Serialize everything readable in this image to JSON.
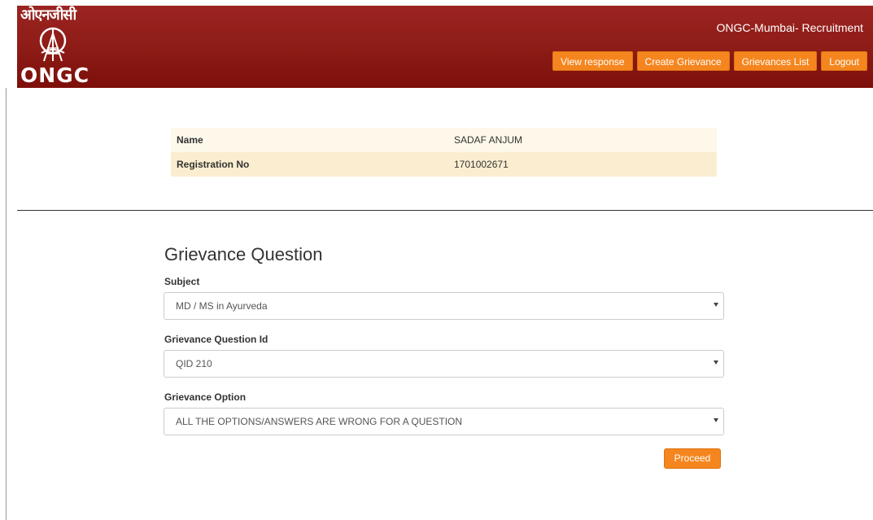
{
  "header": {
    "logo_hindi": "ओएनजीसी",
    "logo_text": "ONGC",
    "site_title": "ONGC-Mumbai- Recruitment",
    "nav": [
      {
        "label": "View response"
      },
      {
        "label": "Create Grievance"
      },
      {
        "label": "Grievances List"
      },
      {
        "label": "Logout"
      }
    ],
    "brand_color": "#8e1c17",
    "accent_color": "#f5861f"
  },
  "candidate": {
    "name_label": "Name",
    "name_value": "SADAF ANJUM",
    "reg_label": "Registration No",
    "reg_value": "1701002671"
  },
  "form": {
    "title": "Grievance Question",
    "subject_label": "Subject",
    "subject_value": "MD / MS in Ayurveda",
    "question_id_label": "Grievance Question Id",
    "question_id_value": "QID 210",
    "option_label": "Grievance Option",
    "option_value": "ALL THE OPTIONS/ANSWERS ARE WRONG FOR A QUESTION",
    "proceed_label": "Proceed"
  }
}
